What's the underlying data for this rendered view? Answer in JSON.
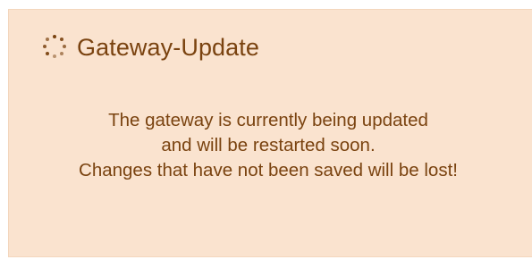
{
  "dialog": {
    "title": "Gateway-Update",
    "icon": "loading-spinner-icon",
    "message_lines": [
      "The gateway is currently being updated",
      "and will be restarted soon.",
      "Changes that have not been saved will be lost!"
    ]
  },
  "colors": {
    "panel_background": "#fae3cf",
    "text": "#7a4310"
  }
}
